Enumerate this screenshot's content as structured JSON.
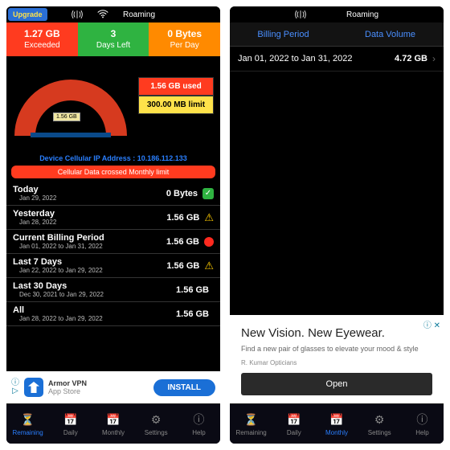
{
  "left": {
    "upgrade": "Upgrade",
    "roaming": "Roaming",
    "stats": {
      "c1a": "1.27 GB",
      "c1b": "Exceeded",
      "c2a": "3",
      "c2b": "Days Left",
      "c3a": "0 Bytes",
      "c3b": "Per Day"
    },
    "gauge_label": "1.56 GB",
    "used": "1.56 GB used",
    "limit": "300.00 MB limit",
    "ip_label": "Device Cellular IP Address : 10.186.112.133",
    "alert": "Cellular Data crossed Monthly limit",
    "rows": [
      {
        "t": "Today",
        "s": "Jan 29, 2022",
        "v": "0 Bytes",
        "b": "green"
      },
      {
        "t": "Yesterday",
        "s": "Jan 28, 2022",
        "v": "1.56 GB",
        "b": "yellow"
      },
      {
        "t": "Current Billing Period",
        "s": "Jan 01, 2022 to Jan 31, 2022",
        "v": "1.56 GB",
        "b": "red"
      },
      {
        "t": "Last 7 Days",
        "s": "Jan 22, 2022 to Jan 29, 2022",
        "v": "1.56 GB",
        "b": "yellow"
      },
      {
        "t": "Last 30 Days",
        "s": "Dec 30, 2021 to Jan 29, 2022",
        "v": "1.56 GB",
        "b": ""
      },
      {
        "t": "All",
        "s": "Jan 28, 2022 to Jan 29, 2022",
        "v": "1.56 GB",
        "b": ""
      }
    ],
    "ad": {
      "title": "Armor VPN",
      "sub": "App Store",
      "btn": "INSTALL"
    }
  },
  "right": {
    "roaming": "Roaming",
    "h1": "Billing Period",
    "h2": "Data Volume",
    "row": {
      "range": "Jan 01, 2022 to Jan 31, 2022",
      "val": "4.72 GB"
    },
    "ad": {
      "title": "New Vision. New Eyewear.",
      "body": "Find a new pair of glasses to elevate your mood & style",
      "src": "R. Kumar Opticians",
      "btn": "Open"
    }
  },
  "tabs": [
    "Remaining",
    "Daily",
    "Monthly",
    "Settings",
    "Help"
  ]
}
